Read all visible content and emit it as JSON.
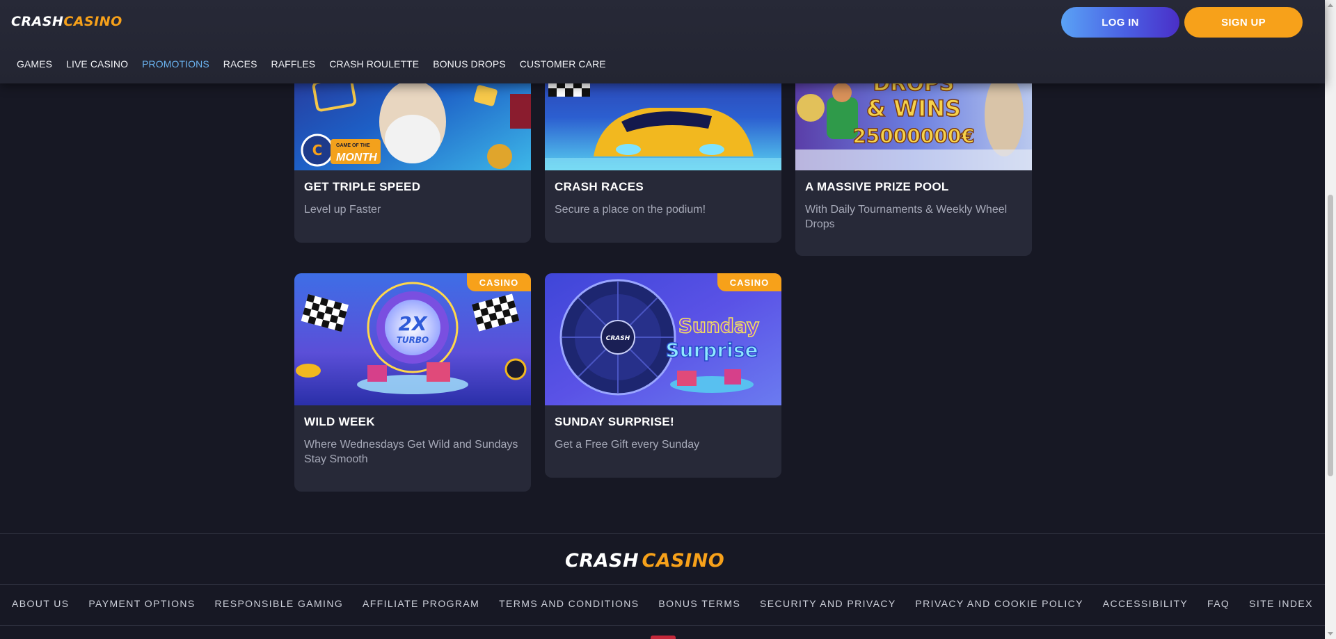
{
  "brand": {
    "logo_text_crash": "CRASH",
    "logo_text_casino": "CASINO",
    "colors": {
      "accent_orange": "#f7a11a",
      "accent_blue": "#6ab3f0",
      "background": "#171824"
    }
  },
  "header": {
    "login_label": "LOG IN",
    "signup_label": "SIGN UP",
    "nav": [
      {
        "label": "GAMES",
        "active": false
      },
      {
        "label": "LIVE CASINO",
        "active": false
      },
      {
        "label": "PROMOTIONS",
        "active": true
      },
      {
        "label": "RACES",
        "active": false
      },
      {
        "label": "RAFFLES",
        "active": false
      },
      {
        "label": "CRASH ROULETTE",
        "active": false
      },
      {
        "label": "BONUS DROPS",
        "active": false
      },
      {
        "label": "CUSTOMER CARE",
        "active": false
      }
    ]
  },
  "promos": [
    {
      "title": "GET TRIPLE SPEED",
      "desc": "Level up Faster",
      "tag": "",
      "image_badge_small": "GAME OF THE",
      "image_badge_big": "MONTH"
    },
    {
      "title": "CRASH RACES",
      "desc": "Secure a place on the podium!",
      "tag": ""
    },
    {
      "title": "A MASSIVE PRIZE POOL",
      "desc": "With Daily Tournaments & Weekly Wheel Drops",
      "tag": "",
      "image_text_line1": "DROPS",
      "image_text_line2": "& WINS",
      "image_text_line3": "25000000€"
    },
    {
      "title": "WILD WEEK",
      "desc": "Where Wednesdays Get Wild and Sundays Stay Smooth",
      "tag": "CASINO",
      "image_text_big": "2X",
      "image_text_small": "TURBO"
    },
    {
      "title": "SUNDAY SURPRISE!",
      "desc": "Get a Free Gift every Sunday",
      "tag": "CASINO",
      "image_text_line1": "Sunday",
      "image_text_line2": "Surprise",
      "wheel_label": "CRASH"
    }
  ],
  "footer": {
    "links": [
      "ABOUT US",
      "PAYMENT OPTIONS",
      "RESPONSIBLE GAMING",
      "AFFILIATE PROGRAM",
      "TERMS AND CONDITIONS",
      "BONUS TERMS",
      "SECURITY AND PRIVACY",
      "PRIVACY AND COOKIE POLICY",
      "ACCESSIBILITY",
      "FAQ",
      "SITE INDEX"
    ]
  }
}
